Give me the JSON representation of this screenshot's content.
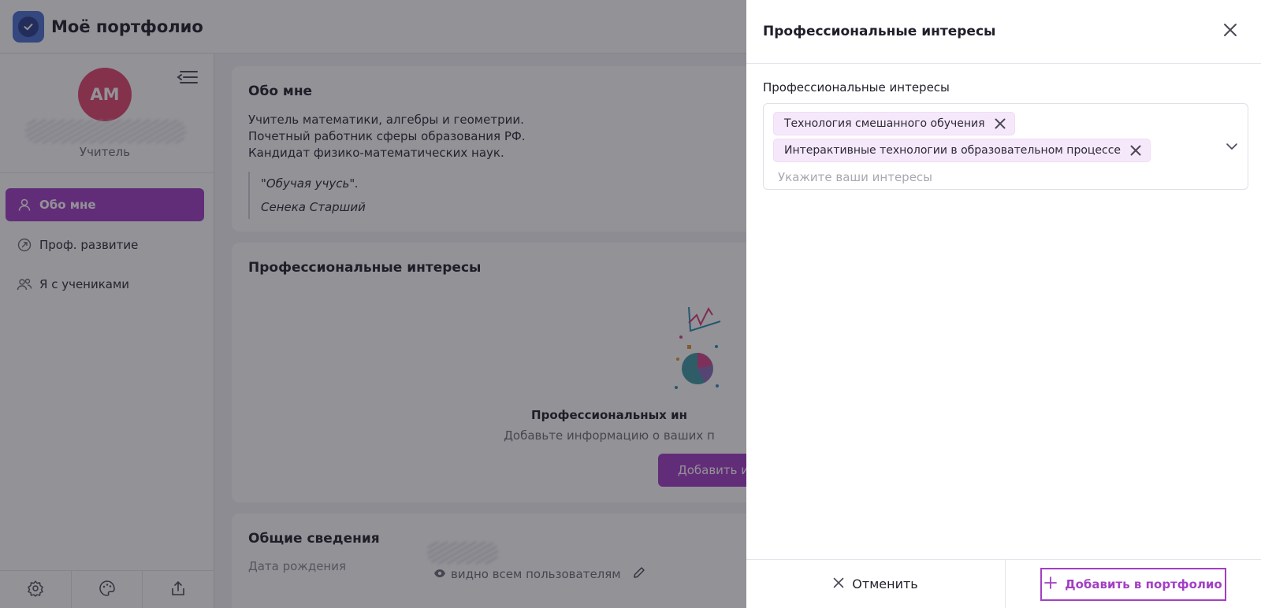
{
  "app": {
    "title": "Моё портфолио"
  },
  "sidebar": {
    "avatar_initials": "АМ",
    "role": "Учитель",
    "items": [
      {
        "label": "Обо мне",
        "icon": "user-icon",
        "active": true
      },
      {
        "label": "Проф. развитие",
        "icon": "growth-icon",
        "active": false
      },
      {
        "label": "Я с учениками",
        "icon": "users-icon",
        "active": false
      }
    ],
    "footer_icons": [
      "gear-icon",
      "palette-icon",
      "share-icon"
    ]
  },
  "about": {
    "title": "Обо мне",
    "lines": [
      "Учитель математики, алгебры и геометрии.",
      "Почетный работник сферы образования РФ.",
      "Кандидат физико-математических наук."
    ],
    "quote": "\"Обучая учусь\".",
    "quote_author": "Сенека Старший"
  },
  "interests_card": {
    "title": "Профессиональные интересы",
    "empty_title": "Профессиональных ин",
    "empty_subtitle": "Добавьте информацию о ваших п",
    "add_button": "Добавить ин"
  },
  "general": {
    "title": "Общие сведения",
    "dob_label": "Дата рождения",
    "visibility": "видно всем пользователям"
  },
  "drawer": {
    "title": "Профессиональные интересы",
    "field_label": "Профессиональные интересы",
    "chips": [
      "Технология смешанного обучения",
      "Интерактивные технологии в образовательном процессе"
    ],
    "placeholder": "Укажите ваши интересы",
    "cancel_label": "Отменить",
    "add_label": "Добавить в портфолио"
  },
  "colors": {
    "accent": "#a23fc4",
    "avatar": "#e2456f",
    "chip_bg": "#f6e8fb"
  }
}
